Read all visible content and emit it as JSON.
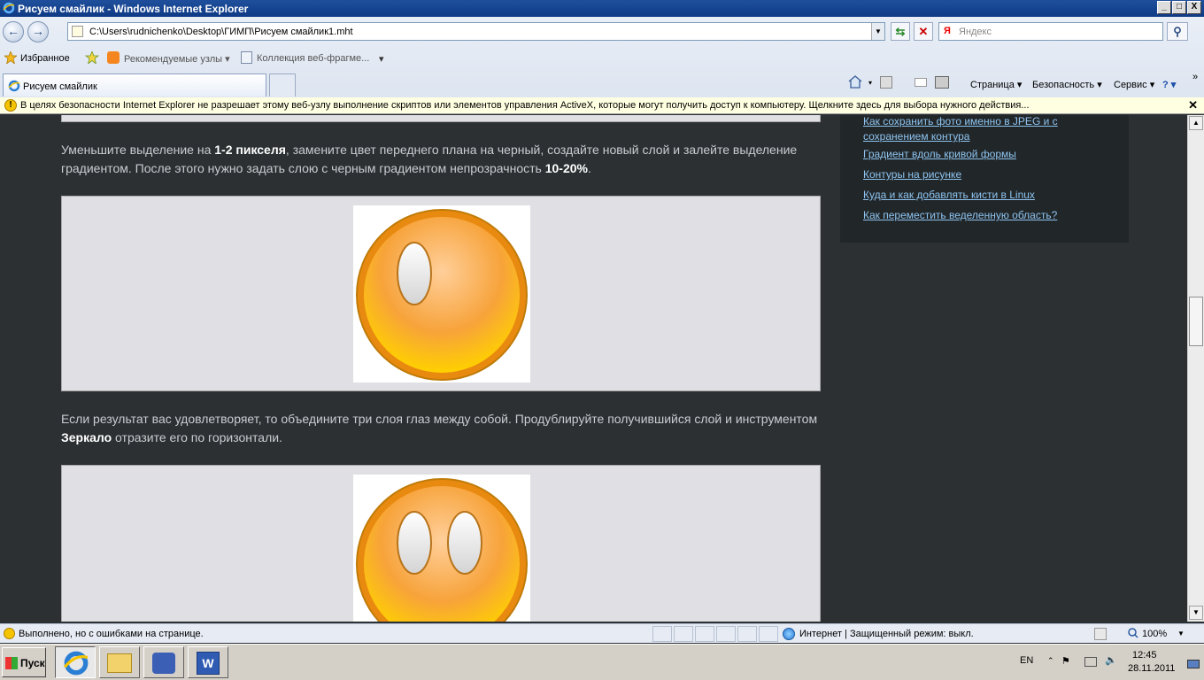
{
  "window": {
    "title": "Рисуем смайлик - Windows Internet Explorer",
    "btn_min": "_",
    "btn_max": "□",
    "btn_close": "X"
  },
  "nav": {
    "back": "←",
    "forward": "→",
    "address": "C:\\Users\\rudnichenko\\Desktop\\ГИМП\\Рисуем смайлик1.mht",
    "search_logo": "Я",
    "search_placeholder": "Яндекс"
  },
  "favorites": {
    "favorites_label": "Избранное",
    "suggested_sites": "Рекомендуемые узлы ▾",
    "web_slice": "Коллекция веб-фрагме...",
    "web_slice_arrow": "▾"
  },
  "tab": {
    "label": "Рисуем смайлик"
  },
  "commandbar": {
    "page": "Страница ▾",
    "safety": "Безопасность ▾",
    "tools": "Сервис ▾",
    "help": "? ▾",
    "more": "»"
  },
  "infobar": {
    "text": "В целях безопасности Internet Explorer не разрешает этому веб-узлу выполнение скриптов или элементов управления ActiveX, которые могут получить доступ к компьютеру. Щелкните здесь для выбора нужного действия...",
    "icon_glyph": "!",
    "close": "✕"
  },
  "content": {
    "para1": {
      "t1": "Уменьшите выделение на ",
      "b1": "1-2 пикселя",
      "t2": ", замените цвет переднего плана на черный, создайте новый слой и залейте выделение градиентом. После этого нужно задать слою с черным градиентом непрозрачность ",
      "b2": "10-20%",
      "t3": "."
    },
    "para2": {
      "t1": "Если результат вас удовлетворяет, то объедините три слоя глаз между собой. Продублируйте получившийся слой и инструментом ",
      "b1": "Зеркало",
      "t2": " отразите его по горизонтали."
    }
  },
  "sidebar": {
    "links": [
      "Как сохранить фото именно в JPEG и с сохранением контура",
      "Градиент вдоль кривой формы",
      "Контуры на рисунке",
      "Куда и как добавлять кисти в Linux",
      "Как переместить веделенную область?"
    ]
  },
  "statusbar": {
    "text": "Выполнено, но с ошибками на странице.",
    "zone": "Интернет | Защищенный режим: выкл.",
    "zoom": "100%"
  },
  "taskbar": {
    "start": "Пуск",
    "lang": "EN",
    "time": "12:45",
    "date": "28.11.2011"
  },
  "colors": {
    "page_bg": "#2c3033",
    "link": "#8ec4ef",
    "panel": "#e0dfe4",
    "smiley_orange": "#f59a1d"
  }
}
